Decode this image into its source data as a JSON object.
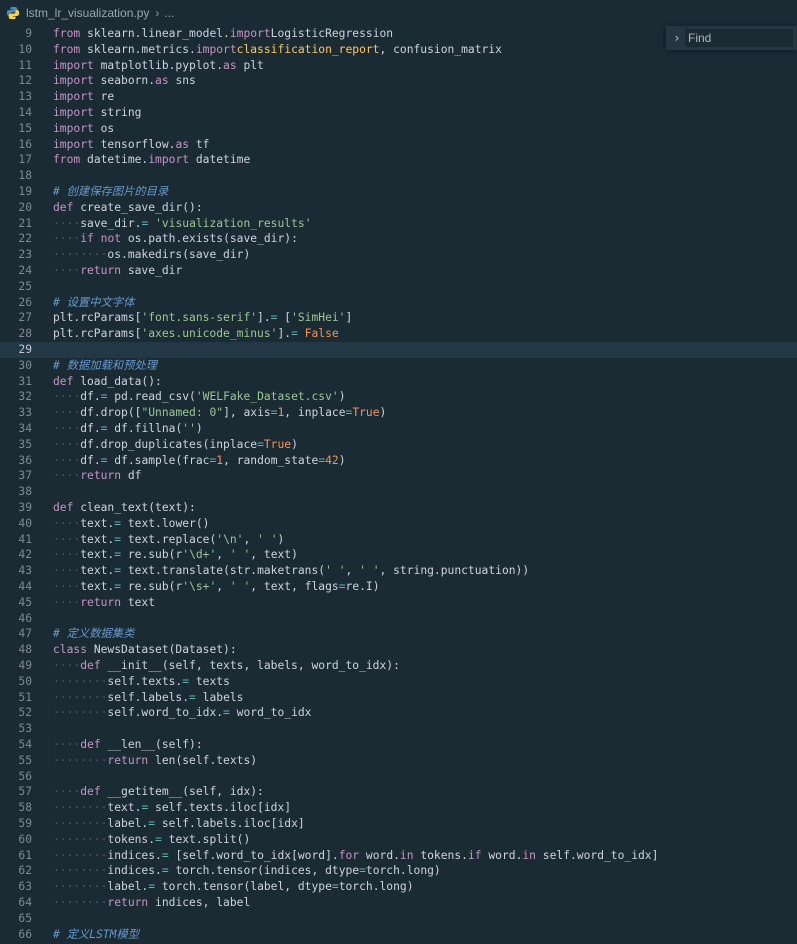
{
  "breadcrumb": {
    "file": "lstm_lr_visualization.py",
    "more": "..."
  },
  "find": {
    "placeholder": "Find"
  },
  "lines": [
    {
      "n": "9",
      "t": [
        [
          "k",
          "from"
        ],
        [
          "",
          ".sklearn.linear_model."
        ],
        [
          "k",
          "import"
        ],
        [
          "",
          "LogisticRegression"
        ]
      ]
    },
    {
      "n": "10",
      "t": [
        [
          "k",
          "from"
        ],
        [
          "",
          ".sklearn.metrics."
        ],
        [
          "k",
          "import"
        ],
        [
          "f",
          "classification_report"
        ],
        [
          "",
          ",.confusion_matrix"
        ]
      ]
    },
    {
      "n": "11",
      "t": [
        [
          "k",
          "import"
        ],
        [
          "",
          ".matplotlib.pyplot."
        ],
        [
          "k",
          "as"
        ],
        [
          "",
          ".plt"
        ]
      ]
    },
    {
      "n": "12",
      "t": [
        [
          "k",
          "import"
        ],
        [
          "",
          ".seaborn."
        ],
        [
          "k",
          "as"
        ],
        [
          "",
          ".sns"
        ]
      ]
    },
    {
      "n": "13",
      "t": [
        [
          "k",
          "import"
        ],
        [
          "",
          ".re"
        ]
      ]
    },
    {
      "n": "14",
      "t": [
        [
          "k",
          "import"
        ],
        [
          "",
          ".string"
        ]
      ]
    },
    {
      "n": "15",
      "t": [
        [
          "k",
          "import"
        ],
        [
          "",
          ".os"
        ]
      ]
    },
    {
      "n": "16",
      "t": [
        [
          "k",
          "import"
        ],
        [
          "",
          ".tensorflow."
        ],
        [
          "k",
          "as"
        ],
        [
          "",
          ".tf"
        ]
      ]
    },
    {
      "n": "17",
      "t": [
        [
          "k",
          "from"
        ],
        [
          "",
          ".datetime."
        ],
        [
          "k",
          "import"
        ],
        [
          "",
          ".datetime"
        ]
      ]
    },
    {
      "n": "18",
      "t": []
    },
    {
      "n": "19",
      "t": [
        [
          "c",
          "# 创建保存图片的目录"
        ]
      ]
    },
    {
      "n": "20",
      "t": [
        [
          "k",
          "def"
        ],
        [
          "",
          ".create_save_dir():"
        ]
      ]
    },
    {
      "n": "21",
      "t": [
        [
          "w",
          "····"
        ],
        [
          "",
          "save_dir."
        ],
        [
          "o",
          "="
        ],
        [
          "",
          "."
        ],
        [
          "s",
          "'visualization_results'"
        ]
      ]
    },
    {
      "n": "22",
      "t": [
        [
          "w",
          "····"
        ],
        [
          "k",
          "if"
        ],
        [
          "",
          "."
        ],
        [
          "k",
          "not"
        ],
        [
          "",
          ".os.path.exists(save_dir):"
        ]
      ]
    },
    {
      "n": "23",
      "t": [
        [
          "w",
          "········"
        ],
        [
          "",
          "os.makedirs(save_dir)"
        ]
      ]
    },
    {
      "n": "24",
      "t": [
        [
          "w",
          "····"
        ],
        [
          "k",
          "return"
        ],
        [
          "",
          ".save_dir"
        ]
      ]
    },
    {
      "n": "25",
      "t": []
    },
    {
      "n": "26",
      "t": [
        [
          "c",
          "# 设置中文字体"
        ]
      ]
    },
    {
      "n": "27",
      "t": [
        [
          "",
          "plt.rcParams["
        ],
        [
          "s",
          "'font.sans-serif'"
        ],
        [
          "",
          "]."
        ],
        [
          "o",
          "="
        ],
        [
          "",
          ".["
        ],
        [
          "s",
          "'SimHei'"
        ],
        [
          "",
          "]"
        ]
      ]
    },
    {
      "n": "28",
      "t": [
        [
          "",
          "plt.rcParams["
        ],
        [
          "s",
          "'axes.unicode_minus'"
        ],
        [
          "",
          "]."
        ],
        [
          "o",
          "="
        ],
        [
          "",
          "."
        ],
        [
          "n",
          "False"
        ]
      ]
    },
    {
      "n": "29",
      "t": [],
      "active": true
    },
    {
      "n": "30",
      "t": [
        [
          "c",
          "# 数据加载和预处理"
        ]
      ]
    },
    {
      "n": "31",
      "t": [
        [
          "k",
          "def"
        ],
        [
          "",
          ".load_data():"
        ]
      ]
    },
    {
      "n": "32",
      "t": [
        [
          "w",
          "····"
        ],
        [
          "",
          "df."
        ],
        [
          "o",
          "="
        ],
        [
          "",
          ".pd.read_csv("
        ],
        [
          "s",
          "'WELFake_Dataset.csv'"
        ],
        [
          "",
          ")"
        ]
      ]
    },
    {
      "n": "33",
      "t": [
        [
          "w",
          "····"
        ],
        [
          "",
          "df.drop(["
        ],
        [
          "s",
          "\"Unnamed: 0\""
        ],
        [
          "",
          "],.axis"
        ],
        [
          "o",
          "="
        ],
        [
          "n",
          "1"
        ],
        [
          "",
          ",.inplace"
        ],
        [
          "o",
          "="
        ],
        [
          "n",
          "True"
        ],
        [
          "",
          ")"
        ]
      ]
    },
    {
      "n": "34",
      "t": [
        [
          "w",
          "····"
        ],
        [
          "",
          "df."
        ],
        [
          "o",
          "="
        ],
        [
          "",
          ".df.fillna("
        ],
        [
          "s",
          "''"
        ],
        [
          "",
          ")"
        ]
      ]
    },
    {
      "n": "35",
      "t": [
        [
          "w",
          "····"
        ],
        [
          "",
          "df.drop_duplicates(inplace"
        ],
        [
          "o",
          "="
        ],
        [
          "n",
          "True"
        ],
        [
          "",
          ")"
        ]
      ]
    },
    {
      "n": "36",
      "t": [
        [
          "w",
          "····"
        ],
        [
          "",
          "df."
        ],
        [
          "o",
          "="
        ],
        [
          "",
          ".df.sample(frac"
        ],
        [
          "o",
          "="
        ],
        [
          "n",
          "1"
        ],
        [
          "",
          ",.random_state"
        ],
        [
          "o",
          "="
        ],
        [
          "n",
          "42"
        ],
        [
          "",
          ")"
        ]
      ]
    },
    {
      "n": "37",
      "t": [
        [
          "w",
          "····"
        ],
        [
          "k",
          "return"
        ],
        [
          "",
          ".df"
        ]
      ]
    },
    {
      "n": "38",
      "t": []
    },
    {
      "n": "39",
      "t": [
        [
          "k",
          "def"
        ],
        [
          "",
          ".clean_text(text):"
        ]
      ]
    },
    {
      "n": "40",
      "t": [
        [
          "w",
          "····"
        ],
        [
          "",
          "text."
        ],
        [
          "o",
          "="
        ],
        [
          "",
          ".text.lower()"
        ]
      ]
    },
    {
      "n": "41",
      "t": [
        [
          "w",
          "····"
        ],
        [
          "",
          "text."
        ],
        [
          "o",
          "="
        ],
        [
          "",
          ".text.replace("
        ],
        [
          "s",
          "'\\n'"
        ],
        [
          "",
          ",."
        ],
        [
          "s",
          "' '"
        ],
        [
          "",
          ")"
        ]
      ]
    },
    {
      "n": "42",
      "t": [
        [
          "w",
          "····"
        ],
        [
          "",
          "text."
        ],
        [
          "o",
          "="
        ],
        [
          "",
          ".re.sub(r"
        ],
        [
          "s",
          "'\\d+'"
        ],
        [
          "",
          ",."
        ],
        [
          "s",
          "' '"
        ],
        [
          "",
          ",.text)"
        ]
      ]
    },
    {
      "n": "43",
      "t": [
        [
          "w",
          "····"
        ],
        [
          "",
          "text."
        ],
        [
          "o",
          "="
        ],
        [
          "",
          ".text.translate(str.maketrans("
        ],
        [
          "s",
          "' '"
        ],
        [
          "",
          ",."
        ],
        [
          "s",
          "' '"
        ],
        [
          "",
          ",.string.punctuation))"
        ]
      ]
    },
    {
      "n": "44",
      "t": [
        [
          "w",
          "····"
        ],
        [
          "",
          "text."
        ],
        [
          "o",
          "="
        ],
        [
          "",
          ".re.sub(r"
        ],
        [
          "s",
          "'\\s+'"
        ],
        [
          "",
          ",."
        ],
        [
          "s",
          "' '"
        ],
        [
          "",
          ",.text,.flags"
        ],
        [
          "o",
          "="
        ],
        [
          "",
          "re.I)"
        ]
      ]
    },
    {
      "n": "45",
      "t": [
        [
          "w",
          "····"
        ],
        [
          "k",
          "return"
        ],
        [
          "",
          ".text"
        ]
      ]
    },
    {
      "n": "46",
      "t": []
    },
    {
      "n": "47",
      "t": [
        [
          "c",
          "# 定义数据集类"
        ]
      ]
    },
    {
      "n": "48",
      "t": [
        [
          "k",
          "class"
        ],
        [
          "",
          ".NewsDataset(Dataset):"
        ]
      ]
    },
    {
      "n": "49",
      "t": [
        [
          "w",
          "····"
        ],
        [
          "k",
          "def"
        ],
        [
          "",
          ".__init__(self,.texts,.labels,.word_to_idx):"
        ]
      ]
    },
    {
      "n": "50",
      "t": [
        [
          "w",
          "········"
        ],
        [
          "",
          "self.texts."
        ],
        [
          "o",
          "="
        ],
        [
          "",
          ".texts"
        ]
      ]
    },
    {
      "n": "51",
      "t": [
        [
          "w",
          "········"
        ],
        [
          "",
          "self.labels."
        ],
        [
          "o",
          "="
        ],
        [
          "",
          ".labels"
        ]
      ]
    },
    {
      "n": "52",
      "t": [
        [
          "w",
          "········"
        ],
        [
          "",
          "self.word_to_idx."
        ],
        [
          "o",
          "="
        ],
        [
          "",
          ".word_to_idx"
        ]
      ]
    },
    {
      "n": "53",
      "t": []
    },
    {
      "n": "54",
      "t": [
        [
          "w",
          "····"
        ],
        [
          "k",
          "def"
        ],
        [
          "",
          ".__len__(self):"
        ]
      ]
    },
    {
      "n": "55",
      "t": [
        [
          "w",
          "········"
        ],
        [
          "k",
          "return"
        ],
        [
          "",
          ".len(self.texts)"
        ]
      ]
    },
    {
      "n": "56",
      "t": []
    },
    {
      "n": "57",
      "t": [
        [
          "w",
          "····"
        ],
        [
          "k",
          "def"
        ],
        [
          "",
          ".__getitem__(self,.idx):"
        ]
      ]
    },
    {
      "n": "58",
      "t": [
        [
          "w",
          "········"
        ],
        [
          "",
          "text."
        ],
        [
          "o",
          "="
        ],
        [
          "",
          ".self.texts.iloc[idx]"
        ]
      ]
    },
    {
      "n": "59",
      "t": [
        [
          "w",
          "········"
        ],
        [
          "",
          "label."
        ],
        [
          "o",
          "="
        ],
        [
          "",
          ".self.labels.iloc[idx]"
        ]
      ]
    },
    {
      "n": "60",
      "t": [
        [
          "w",
          "········"
        ],
        [
          "",
          "tokens."
        ],
        [
          "o",
          "="
        ],
        [
          "",
          ".text.split()"
        ]
      ]
    },
    {
      "n": "61",
      "t": [
        [
          "w",
          "········"
        ],
        [
          "",
          "indices."
        ],
        [
          "o",
          "="
        ],
        [
          "",
          ".[self.word_to_idx[word]."
        ],
        [
          "k",
          "for"
        ],
        [
          "",
          ".word."
        ],
        [
          "k",
          "in"
        ],
        [
          "",
          ".tokens."
        ],
        [
          "k",
          "if"
        ],
        [
          "",
          ".word."
        ],
        [
          "k",
          "in"
        ],
        [
          "",
          ".self.word_to_idx]"
        ]
      ]
    },
    {
      "n": "62",
      "t": [
        [
          "w",
          "········"
        ],
        [
          "",
          "indices."
        ],
        [
          "o",
          "="
        ],
        [
          "",
          ".torch.tensor(indices,.dtype"
        ],
        [
          "o",
          "="
        ],
        [
          "",
          "torch.long)"
        ]
      ]
    },
    {
      "n": "63",
      "t": [
        [
          "w",
          "········"
        ],
        [
          "",
          "label."
        ],
        [
          "o",
          "="
        ],
        [
          "",
          ".torch.tensor(label,.dtype"
        ],
        [
          "o",
          "="
        ],
        [
          "",
          "torch.long)"
        ]
      ]
    },
    {
      "n": "64",
      "t": [
        [
          "w",
          "········"
        ],
        [
          "k",
          "return"
        ],
        [
          "",
          ".indices,.label"
        ]
      ]
    },
    {
      "n": "65",
      "t": []
    },
    {
      "n": "66",
      "t": [
        [
          "c",
          "# 定义LSTM模型"
        ]
      ]
    }
  ]
}
